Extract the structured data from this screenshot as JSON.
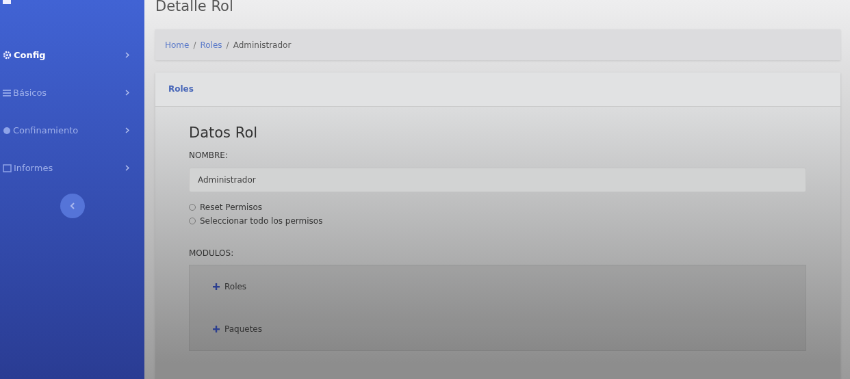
{
  "sidebar": {
    "items": [
      {
        "label": "Config",
        "selected": true
      },
      {
        "label": "Básicos",
        "selected": false
      },
      {
        "label": "Confinamiento",
        "selected": false
      },
      {
        "label": "Informes",
        "selected": false
      }
    ]
  },
  "page_title": "Detalle Rol",
  "breadcrumb": [
    {
      "label": "Home",
      "link": true
    },
    {
      "label": "Roles",
      "link": true,
      "separator": "/"
    },
    {
      "label": "Administrador",
      "link": false,
      "separator": "/"
    }
  ],
  "card": {
    "header": "Roles",
    "title": "Datos Rol",
    "name_label": "NOMBRE:",
    "name_value": "Administrador",
    "options": [
      {
        "label": "Reset Permisos",
        "selected": false
      },
      {
        "label": "Seleccionar todo los permisos",
        "selected": false
      }
    ],
    "modules_label": "MODULOS:",
    "modules": [
      {
        "label": "Roles",
        "expanded": false
      },
      {
        "label": "Paquetes",
        "expanded": false
      }
    ]
  }
}
